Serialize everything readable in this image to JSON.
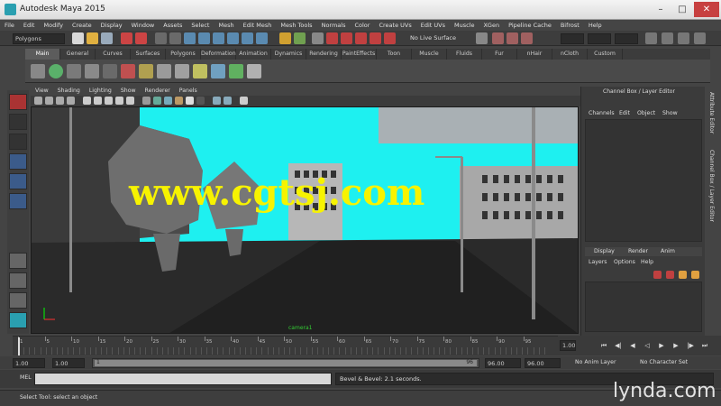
{
  "window": {
    "title": "Autodesk Maya 2015",
    "min": "–",
    "max": "□",
    "close": "✕"
  },
  "menu": [
    "File",
    "Edit",
    "Modify",
    "Create",
    "Display",
    "Window",
    "Assets",
    "Select",
    "Mesh",
    "Edit Mesh",
    "Mesh Tools",
    "Normals",
    "Color",
    "Create UVs",
    "Edit UVs",
    "Muscle",
    "XGen",
    "Pipeline Cache",
    "Bifrost",
    "Help"
  ],
  "status": {
    "mode": "Polygons",
    "live_surface": "No Live Surface"
  },
  "shelf_tabs": [
    "Main",
    "General",
    "Curves",
    "Surfaces",
    "Polygons",
    "Deformation",
    "Animation",
    "Dynamics",
    "Rendering",
    "PaintEffects",
    "Toon",
    "Muscle",
    "Fluids",
    "Fur",
    "nHair",
    "nCloth",
    "Custom"
  ],
  "panel_menu": [
    "View",
    "Shading",
    "Lighting",
    "Show",
    "Renderer",
    "Panels"
  ],
  "viewport": {
    "camera_label": "camera1",
    "watermark": "www.cgtsj.com"
  },
  "channel_box": {
    "title": "Channel Box / Layer Editor",
    "menu": [
      "Channels",
      "Edit",
      "Object",
      "Show"
    ],
    "layer_tabs": [
      "Display",
      "Render",
      "Anim"
    ],
    "layer_menu": [
      "Layers",
      "Options",
      "Help"
    ]
  },
  "side_tabs": [
    "Attribute Editor",
    "Channel Box / Layer Editor"
  ],
  "timeline": {
    "ticks": [
      "1",
      "5",
      "10",
      "15",
      "20",
      "25",
      "30",
      "35",
      "40",
      "45",
      "50",
      "55",
      "60",
      "65",
      "70",
      "75",
      "80",
      "85",
      "90",
      "95"
    ],
    "current_frame": "1.00"
  },
  "range": {
    "start": "1.00",
    "inner_start": "1.00",
    "slider_start": "1",
    "slider_end": "96",
    "inner_end": "96.00",
    "end": "96.00",
    "anim_layer": "No Anim Layer",
    "character_set": "No Character Set"
  },
  "cmd": {
    "lang": "MEL",
    "result": "Bevel & Bevel: 2.1 seconds."
  },
  "help_line": "Select Tool: select an object",
  "brand": "lynda.com",
  "colors": {
    "sky": "#1ef0f0",
    "ground": "#2a2a2a",
    "watermark": "#f7f300",
    "accent": "#2a9fb0"
  }
}
